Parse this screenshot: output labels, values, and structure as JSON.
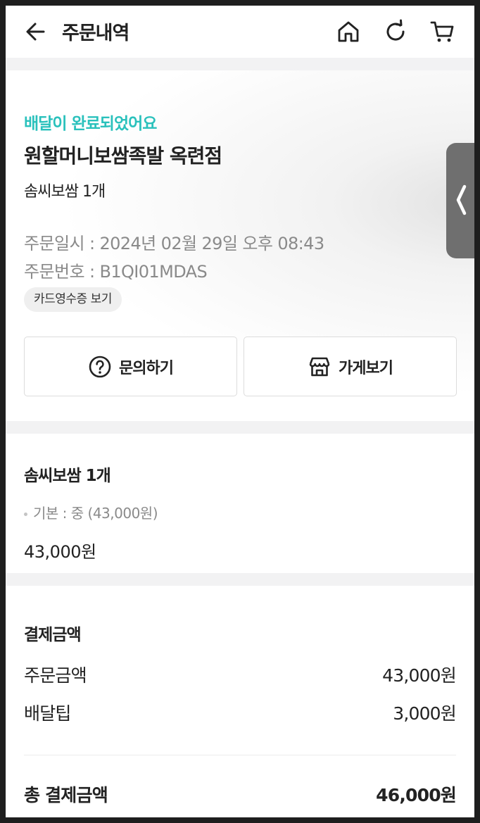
{
  "header": {
    "title": "주문내역",
    "icons": [
      "back-arrow-icon",
      "home-icon",
      "refresh-icon",
      "cart-icon"
    ]
  },
  "order": {
    "status": "배달이 완료되었어요",
    "store_name": "원할머니보쌈족발 옥련점",
    "menu_summary": "솜씨보쌈 1개",
    "order_datetime": "주문일시 : 2024년 02월 29일 오후 08:43",
    "order_number": "주문번호 : B1QI01MDAS",
    "receipt_label": "카드영수증 보기",
    "inquiry_label": "문의하기",
    "store_view_label": "가게보기"
  },
  "menu": {
    "name": "솜씨보쌈 1개",
    "option": "기본 : 중 (43,000원)",
    "price": "43,000원"
  },
  "payment": {
    "title": "결제금액",
    "rows": [
      {
        "label": "주문금액",
        "value": "43,000원"
      },
      {
        "label": "배달팁",
        "value": "3,000원"
      }
    ],
    "total_label": "총 결제금액",
    "total_value": "46,000원"
  },
  "colors": {
    "accent": "#2ac1bc",
    "text": "#222222",
    "muted": "#8a8a8a",
    "divider": "#f2f2f3"
  }
}
